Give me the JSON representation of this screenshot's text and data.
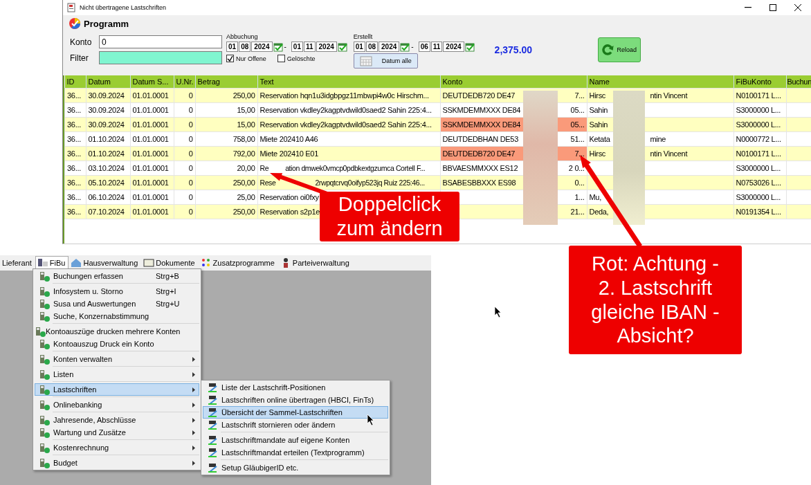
{
  "window": {
    "title": "Nicht übertragene Lastschriften",
    "toolbar_title": "Programm",
    "konto": {
      "label": "Konto",
      "value": "0"
    },
    "filter": {
      "label": "Filter"
    },
    "abbuchung": {
      "label": "Abbuchung",
      "from": [
        "01",
        "08",
        "2024"
      ],
      "dash": "-",
      "to": [
        "01",
        "11",
        "2024"
      ]
    },
    "checkboxes": [
      {
        "label": "Nur Offene",
        "checked": true
      },
      {
        "label": "Gelöschte",
        "checked": false
      }
    ],
    "erstellt": {
      "label": "Erstellt",
      "from": [
        "01",
        "08",
        "2024"
      ],
      "dash": "-",
      "to": [
        "06",
        "11",
        "2024"
      ]
    },
    "datum_alle": "Datum alle",
    "total": "2,375.00",
    "reload": "Reload",
    "table": {
      "columns": [
        "ID",
        "Datum",
        "Datum S...",
        "U.Nr.",
        "Betrag",
        "Text",
        "Konto",
        "Name",
        "FiBuKonto",
        "Buchun"
      ],
      "rows": [
        {
          "id": "36...",
          "datum": "30.09.2024",
          "datum_s": "01.01.0001",
          "unr": "0",
          "betrag": "250,00",
          "text": "Reservation hqn1u3idgbpgz11mbwpi4w0c Hirschm...",
          "konto_start": "DEUTDEDB720 DE47",
          "konto_end": "7...",
          "konto_warning": false,
          "name_start": "Hirsc",
          "name_end": "ntin Vincent",
          "fibukonto": "N0100171 L..."
        },
        {
          "id": "36...",
          "datum": "30.09.2024",
          "datum_s": "01.01.0001",
          "unr": "0",
          "betrag": "15,00",
          "text": "Reservation vkdley2kagptvdwild0saed2 Sahin 225:4...",
          "konto_start": "SSKMDEMMXXX DE84",
          "konto_end": "05...",
          "konto_warning": false,
          "name_start": "Sahin",
          "fibukonto": "S3000000 L..."
        },
        {
          "id": "36...",
          "datum": "30.09.2024",
          "datum_s": "01.01.0001",
          "unr": "0",
          "betrag": "15,00",
          "text": "Reservation vkdley2kagptvdwild0saed2 Sahin 225:4...",
          "konto_start": "SSKMDEMMXXX DE84",
          "konto_end": "05...",
          "konto_warning": true,
          "name_start": "Sahin",
          "fibukonto": "S3000000 L..."
        },
        {
          "id": "36...",
          "datum": "01.10.2024",
          "datum_s": "01.01.0001",
          "unr": "0",
          "betrag": "758,00",
          "text": "Miete 202410 A46",
          "konto_start": "DEUTDEDBHAN DE53",
          "konto_end": "51...",
          "konto_warning": false,
          "name_start": "Ketata",
          "name_end": "mine",
          "fibukonto": "N0000772 L..."
        },
        {
          "id": "36...",
          "datum": "01.10.2024",
          "datum_s": "01.01.0001",
          "unr": "0",
          "betrag": "792,00",
          "text": "Miete 202410 E01",
          "konto_start": "DEUTDEDB720 DE47",
          "konto_end": "7...",
          "konto_warning": true,
          "name_start": "Hirsc",
          "name_end": "ntin Vincent",
          "fibukonto": "N0100171 L..."
        },
        {
          "id": "36...",
          "datum": "03.10.2024",
          "datum_s": "01.01.0001",
          "unr": "0",
          "betrag": "20,00",
          "text": "Re",
          "text_after": "ation dmwek0vmcp0pdbkextgzumca Cortell F...",
          "konto_start": "BBVAESMMXXX ES12",
          "konto_end": "2 0...",
          "konto_warning": false,
          "fibukonto": "S3000000 L..."
        },
        {
          "id": "36...",
          "datum": "05.10.2024",
          "datum_s": "01.01.0001",
          "unr": "0",
          "betrag": "250,00",
          "text": "Rese",
          "text_after": "2rwpqtcrvq0oifyp523jq Ruiz 225:46...",
          "konto_start": "BSABESBBXXX ES98",
          "konto_end": "0...",
          "konto_warning": false,
          "fibukonto": "N0753026 L..."
        },
        {
          "id": "36...",
          "datum": "06.10.2024",
          "datum_s": "01.01.0001",
          "unr": "0",
          "betrag": "25,00",
          "text": "Reservation oi0fxy",
          "konto_end": "1...",
          "konto_warning": false,
          "name_start": "Mu,",
          "fibukonto": "S3000000 L..."
        },
        {
          "id": "36...",
          "datum": "07.10.2024",
          "datum_s": "01.01.0001",
          "unr": "0",
          "betrag": "250,00",
          "text": "Reservation s2p1e",
          "konto_end": "21...",
          "konto_warning": false,
          "name_start": "Deda,",
          "fibukonto": "N0191354 L..."
        }
      ]
    }
  },
  "app": {
    "menubar": [
      {
        "label": "Lieferant",
        "selected": false
      },
      {
        "label": "FiBu",
        "selected": true
      },
      {
        "label": "Hausverwaltung",
        "selected": false
      },
      {
        "label": "Dokumente",
        "selected": false
      },
      {
        "label": "Zusatzprogramme",
        "selected": false
      },
      {
        "label": "Parteiverwaltung",
        "selected": false
      }
    ],
    "menu": [
      {
        "label": "Buchungen erfassen",
        "shortcut": "Strg+B",
        "separator": false,
        "submenu": false,
        "selected": false
      },
      {
        "label": "Infosystem u. Storno",
        "shortcut": "Strg+I",
        "separator": true,
        "submenu": false,
        "selected": false
      },
      {
        "label": "Susa und Auswertungen",
        "shortcut": "Strg+U",
        "separator": false,
        "submenu": false,
        "selected": false
      },
      {
        "label": "Suche, Konzernabstimmung",
        "separator": false,
        "submenu": false,
        "selected": false
      },
      {
        "label": "Kontoauszüge drucken mehrere Konten",
        "separator": true,
        "submenu": false,
        "selected": false
      },
      {
        "label": "Kontoauszug Druck ein Konto",
        "separator": false,
        "submenu": false,
        "selected": false
      },
      {
        "label": "Konten verwalten",
        "separator": true,
        "submenu": true,
        "selected": false
      },
      {
        "label": "Listen",
        "separator": true,
        "submenu": true,
        "selected": false
      },
      {
        "label": "Lastschriften",
        "separator": true,
        "submenu": true,
        "selected": true
      },
      {
        "label": "Onlinebanking",
        "separator": true,
        "submenu": true,
        "selected": false
      },
      {
        "label": "Jahresende, Abschlüsse",
        "separator": true,
        "submenu": true,
        "selected": false
      },
      {
        "label": "Wartung und Zusätze",
        "separator": false,
        "submenu": true,
        "selected": false
      },
      {
        "label": "Kostenrechnung",
        "separator": true,
        "submenu": true,
        "selected": false
      },
      {
        "label": "Budget",
        "separator": true,
        "submenu": true,
        "selected": false
      }
    ],
    "submenu": [
      {
        "label": "Liste der Lastschrift-Positionen",
        "separator": false,
        "selected": false
      },
      {
        "label": "Lastschriften online übertragen (HBCI, FinTs)",
        "separator": false,
        "selected": false
      },
      {
        "label": "Übersicht der Sammel-Lastschriften",
        "separator": false,
        "selected": true
      },
      {
        "label": "Lastschrift stornieren oder ändern",
        "separator": false,
        "selected": false
      },
      {
        "label": "Lastschriftmandate auf eigene Konten",
        "separator": true,
        "selected": false
      },
      {
        "label": "Lastschriftmandat erteilen (Textprogramm)",
        "separator": false,
        "selected": false
      },
      {
        "label": "Setup GläubigerID etc.",
        "separator": true,
        "selected": false
      }
    ]
  },
  "callouts": [
    "Doppelclick\nzum ändern",
    "Rot: Achtung -\n2. Lastschrift\ngleiche IBAN -\nAbsicht?"
  ]
}
